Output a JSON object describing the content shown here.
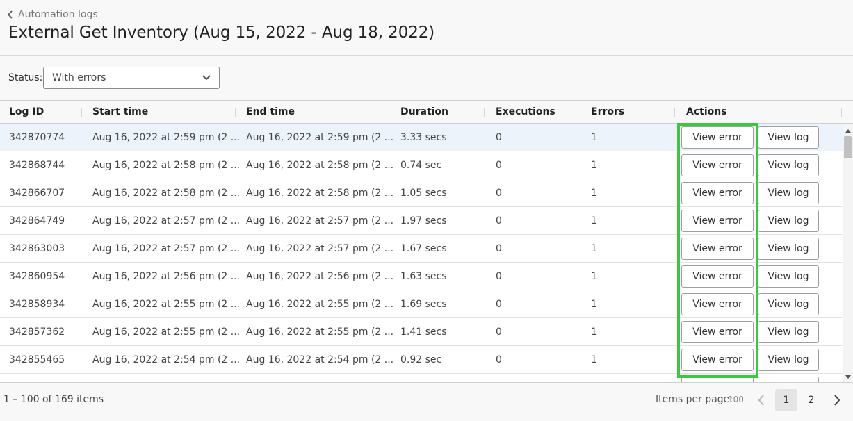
{
  "header": {
    "back_label": "Automation logs",
    "title": "External Get Inventory (Aug 15, 2022 - Aug 18, 2022)"
  },
  "filter": {
    "label": "Status:",
    "selected": "With errors"
  },
  "columns": [
    "Log ID",
    "Start time",
    "End time",
    "Duration",
    "Executions",
    "Errors",
    "Actions"
  ],
  "rows": [
    {
      "id": "342870774",
      "start": "Aug 16, 2022 at 2:59 pm (2 ...",
      "end": "Aug 16, 2022 at 2:59 pm (2 ...",
      "duration": "3.33 secs",
      "executions": "0",
      "errors": "1",
      "error_btn": "View error",
      "log_btn": "View log"
    },
    {
      "id": "342868744",
      "start": "Aug 16, 2022 at 2:58 pm (2 ...",
      "end": "Aug 16, 2022 at 2:58 pm (2 ...",
      "duration": "0.74 sec",
      "executions": "0",
      "errors": "1",
      "error_btn": "View error",
      "log_btn": "View log"
    },
    {
      "id": "342866707",
      "start": "Aug 16, 2022 at 2:58 pm (2 ...",
      "end": "Aug 16, 2022 at 2:58 pm (2 ...",
      "duration": "1.05 secs",
      "executions": "0",
      "errors": "1",
      "error_btn": "View error",
      "log_btn": "View log"
    },
    {
      "id": "342864749",
      "start": "Aug 16, 2022 at 2:57 pm (2 ...",
      "end": "Aug 16, 2022 at 2:57 pm (2 ...",
      "duration": "1.97 secs",
      "executions": "0",
      "errors": "1",
      "error_btn": "View error",
      "log_btn": "View log"
    },
    {
      "id": "342863003",
      "start": "Aug 16, 2022 at 2:57 pm (2 ...",
      "end": "Aug 16, 2022 at 2:57 pm (2 ...",
      "duration": "1.67 secs",
      "executions": "0",
      "errors": "1",
      "error_btn": "View error",
      "log_btn": "View log"
    },
    {
      "id": "342860954",
      "start": "Aug 16, 2022 at 2:56 pm (2 ...",
      "end": "Aug 16, 2022 at 2:56 pm (2 ...",
      "duration": "1.63 secs",
      "executions": "0",
      "errors": "1",
      "error_btn": "View error",
      "log_btn": "View log"
    },
    {
      "id": "342858934",
      "start": "Aug 16, 2022 at 2:55 pm (2 ...",
      "end": "Aug 16, 2022 at 2:55 pm (2 ...",
      "duration": "1.69 secs",
      "executions": "0",
      "errors": "1",
      "error_btn": "View error",
      "log_btn": "View log"
    },
    {
      "id": "342857362",
      "start": "Aug 16, 2022 at 2:55 pm (2 ...",
      "end": "Aug 16, 2022 at 2:55 pm (2 ...",
      "duration": "1.41 secs",
      "executions": "0",
      "errors": "1",
      "error_btn": "View error",
      "log_btn": "View log"
    },
    {
      "id": "342855465",
      "start": "Aug 16, 2022 at 2:54 pm (2 ...",
      "end": "Aug 16, 2022 at 2:54 pm (2 ...",
      "duration": "0.92 sec",
      "executions": "0",
      "errors": "1",
      "error_btn": "View error",
      "log_btn": "View log"
    },
    {
      "id": "",
      "start": "",
      "end": "",
      "duration": "",
      "executions": "",
      "errors": "",
      "error_btn": "",
      "log_btn": ""
    }
  ],
  "footer": {
    "range": "1 – 100 of 169 items",
    "items_per_page_label": "Items per page:",
    "items_per_page_value": "100",
    "pages": [
      "1",
      "2"
    ],
    "current_page": "1"
  },
  "colors": {
    "highlight": "#3ec63e",
    "selected_row": "#edf3fb"
  }
}
